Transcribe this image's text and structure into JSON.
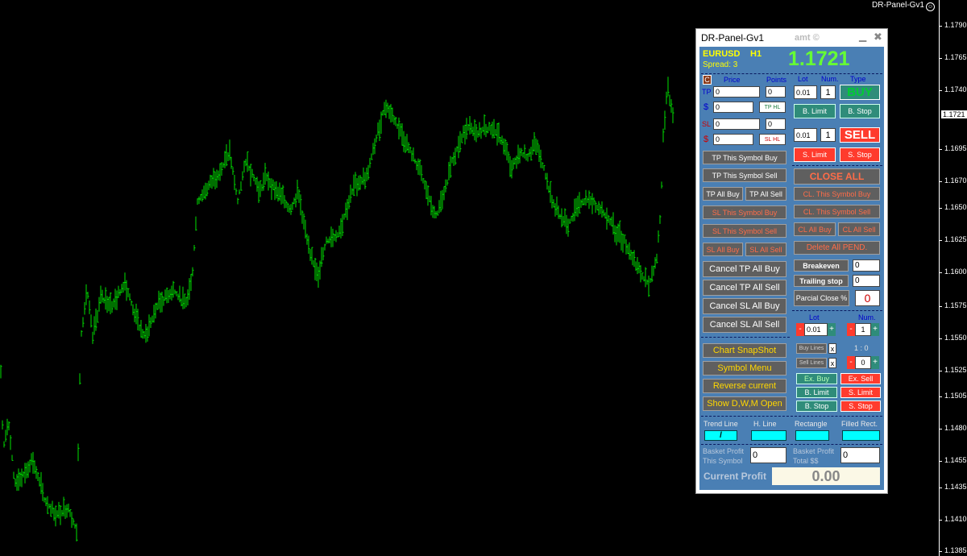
{
  "window": {
    "indicator_label": "DR-Panel-Gv1"
  },
  "price_axis": {
    "ticks": [
      "1.1790",
      "1.1765",
      "1.1740",
      "1.1721",
      "1.1695",
      "1.1670",
      "1.1650",
      "1.1625",
      "1.1600",
      "1.1575",
      "1.1550",
      "1.1525",
      "1.1505",
      "1.1480",
      "1.1455",
      "1.1435",
      "1.1410",
      "1.1385"
    ],
    "current_price": "1.1721"
  },
  "colors": {
    "candles": "#00e000",
    "panel_bg": "#4a7fb4",
    "buy": "#2f8c7a",
    "sell": "#ff3b2d",
    "accent_green": "#66ff33"
  },
  "panel": {
    "title": "DR-Panel-Gv1",
    "brand": "amt ©",
    "minimize_icon": "minimize-icon",
    "close_icon": "close-icon",
    "symbol": "EURUSD",
    "timeframe": "H1",
    "spread": "Spread: 3",
    "bid_price": "1.1721",
    "left": {
      "c_button": "C",
      "price_header": "Price",
      "points_header": "Points",
      "tp_label": "TP",
      "tp_price": "0",
      "tp_points": "0",
      "tp_dollar_label": "$",
      "tp_dollar": "0",
      "tp_hl": "TP HL",
      "sl_label": "SL",
      "sl_price": "0",
      "sl_points": "0",
      "sl_dollar_label": "$",
      "sl_dollar": "0",
      "sl_hl": "SL HL",
      "tp_this_symbol_buy": "TP This Symbol Buy",
      "tp_this_symbol_sell": "TP This Symbol Sell",
      "tp_all_buy": "TP All Buy",
      "tp_all_sell": "TP All Sell",
      "sl_this_symbol_buy": "SL This Symbol Buy",
      "sl_this_symbol_sell": "SL This Symbol Sell",
      "sl_all_buy": "SL All Buy",
      "sl_all_sell": "SL All Sell",
      "cancel_tp_all_buy": "Cancel  TP  All Buy",
      "cancel_tp_all_sell": "Cancel  TP  All Sell",
      "cancel_sl_all_buy": "Cancel  SL  All Buy",
      "cancel_sl_all_sell": "Cancel  SL  All Sell",
      "chart_snapshot": "Chart SnapShot",
      "symbol_menu": "Symbol Menu",
      "reverse_current": "Reverse current",
      "show_dwm_open": "Show D,W,M Open"
    },
    "right": {
      "lot_header": "Lot",
      "num_header": "Num.",
      "type_header": "Type",
      "buy_lot": "0.01",
      "buy_num": "1",
      "buy": "BUY",
      "b_limit": "B. Limit",
      "b_stop": "B. Stop",
      "sell_lot": "0.01",
      "sell_num": "1",
      "sell": "SELL",
      "s_limit": "S. Limit",
      "s_stop": "S. Stop",
      "close_all": "CLOSE  ALL",
      "cl_this_symbol_buy": "CL. This Symbol Buy",
      "cl_this_symbol_sell": "CL. This Symbol Sell",
      "cl_all_buy": "CL All Buy",
      "cl_all_sell": "CL All Sell",
      "delete_all_pend": "Delete All PEND.",
      "breakeven": "Breakeven",
      "breakeven_value": "0",
      "trailing_stop": "Trailing stop",
      "trailing_value": "0",
      "partial_close": "Parcial Close %",
      "partial_value": "0",
      "lot2_header": "Lot",
      "num2_header": "Num.",
      "lot2_value": "0.01",
      "num2_value": "1",
      "minus": "-",
      "plus": "+",
      "buy_lines": "Buy  Lines",
      "sell_lines": "Sell  Lines",
      "x": "x",
      "ratio": "1 : 0",
      "ratio_value": "0",
      "ex_buy": "Ex. Buy",
      "ex_sell": "Ex. Sell",
      "b_limit2": "B. Limit",
      "s_limit2": "S. Limit",
      "b_stop2": "B. Stop",
      "s_stop2": "S. Stop"
    },
    "drawing": {
      "trend_line": "Trend Line",
      "trend_line_symbol": "/",
      "h_line": "H. Line",
      "rectangle": "Rectangle",
      "filled_rect": "Filled Rect."
    },
    "basket": {
      "this_symbol_label_1": "Basket Profit",
      "this_symbol_label_2": "This Symbol",
      "this_symbol_value": "0",
      "total_label_1": "Basket Profit",
      "total_label_2": "Total $$",
      "total_value": "0",
      "current_profit_label": "Current Profit",
      "current_profit_value": "0.00"
    }
  }
}
